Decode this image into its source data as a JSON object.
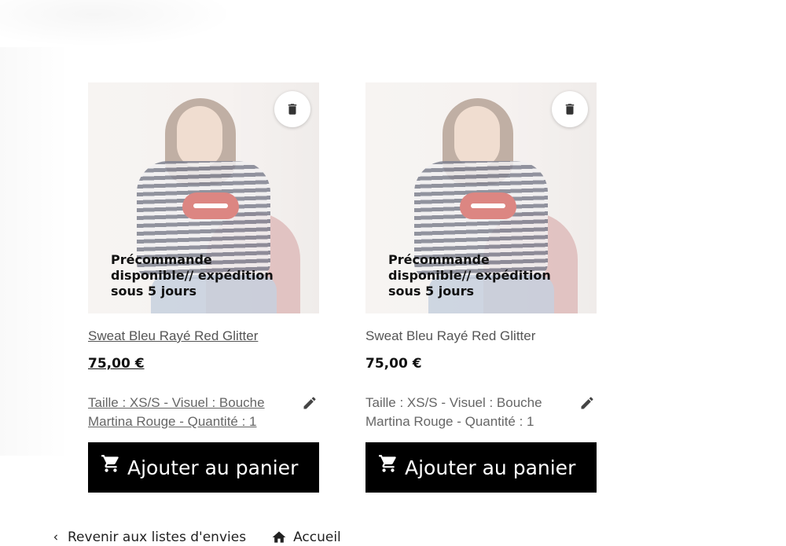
{
  "colors": {
    "button_bg": "#000000",
    "button_text": "#ffffff",
    "text_muted": "#666666"
  },
  "products": [
    {
      "name": "Sweat Bleu Rayé Red Glitter",
      "price": "75,00 €",
      "badge": "Précommande disponible// expédition sous 5 jours",
      "attributes": "Taille : XS/S - Visuel : Bouche Martina Rouge - Quantité : 1",
      "add_to_cart": "Ajouter au panier",
      "icons": {
        "delete": "trash-icon",
        "edit": "pencil-icon",
        "cart": "cart-icon"
      }
    },
    {
      "name": "Sweat Bleu Rayé Red Glitter",
      "price": "75,00 €",
      "badge": "Précommande disponible// expédition sous 5 jours",
      "attributes": "Taille : XS/S - Visuel : Bouche Martina Rouge - Quantité : 1",
      "add_to_cart": "Ajouter au panier",
      "icons": {
        "delete": "trash-icon",
        "edit": "pencil-icon",
        "cart": "cart-icon"
      }
    }
  ],
  "footer": {
    "back_label": "Revenir aux listes d'envies",
    "home_label": "Accueil",
    "icons": {
      "back": "chevron-left-icon",
      "home": "home-icon"
    }
  }
}
